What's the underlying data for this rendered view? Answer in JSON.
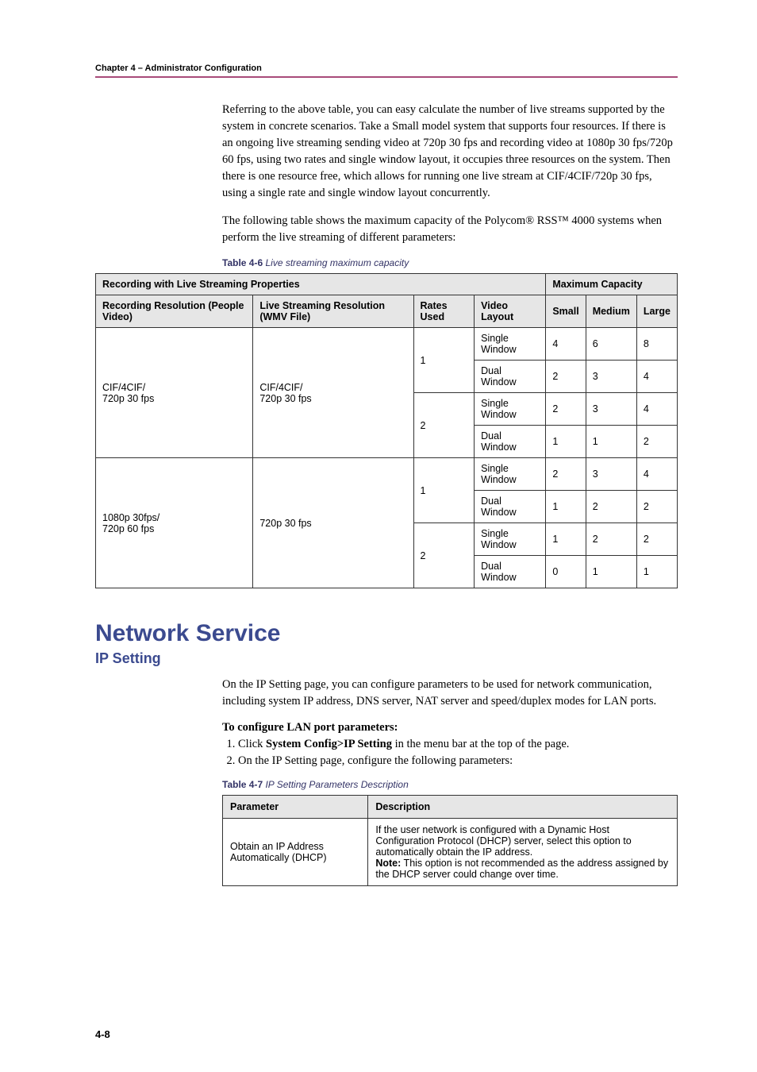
{
  "header": {
    "chapter": "Chapter 4 – Administrator Configuration"
  },
  "paragraphs": {
    "p1": "Referring to the above table, you can easy calculate the number of live streams supported by the system in concrete scenarios. Take a Small model system that supports four resources. If there is an ongoing live streaming sending video at 720p 30 fps and recording video at 1080p 30 fps/720p 60 fps, using two rates and single window layout, it occupies three resources on the system. Then there is one resource free, which allows for running one live stream at CIF/4CIF/720p 30 fps, using a single rate and single window layout concurrently.",
    "p2": "The following table shows the maximum capacity of the Polycom® RSS™ 4000 systems when perform the live streaming of different parameters:",
    "p3": "On the IP Setting page, you can configure parameters to be used for network communication, including system IP address, DNS server, NAT server and speed/duplex modes for LAN ports.",
    "steps_header": "To configure LAN port parameters:",
    "step1_pre": "Click ",
    "step1_bold": "System Config>IP Setting",
    "step1_post": " in the menu bar at the top of the page.",
    "step2": "On the IP Setting page, configure the following parameters:"
  },
  "table46": {
    "caption_bold": "Table 4-6",
    "caption_em": " Live streaming maximum capacity",
    "header_group1": "Recording with Live Streaming Properties",
    "header_group2": "Maximum Capacity",
    "col_rec": "Recording Resolution (People Video)",
    "col_live": "Live Streaming Resolution (WMV File)",
    "col_rates": "Rates Used",
    "col_layout": "Video Layout",
    "col_small": "Small",
    "col_medium": "Medium",
    "col_large": "Large",
    "rec1": "CIF/4CIF/\n720p 30 fps",
    "live1": "CIF/4CIF/\n720p 30 fps",
    "rec2": "1080p 30fps/\n720p 60 fps",
    "live2": "720p 30 fps",
    "rate1": "1",
    "rate2": "2",
    "layout_single": "Single Window",
    "layout_dual": "Dual Window",
    "r1": {
      "s": "4",
      "m": "6",
      "l": "8"
    },
    "r2": {
      "s": "2",
      "m": "3",
      "l": "4"
    },
    "r3": {
      "s": "2",
      "m": "3",
      "l": "4"
    },
    "r4": {
      "s": "1",
      "m": "1",
      "l": "2"
    },
    "r5": {
      "s": "2",
      "m": "3",
      "l": "4"
    },
    "r6": {
      "s": "1",
      "m": "2",
      "l": "2"
    },
    "r7": {
      "s": "1",
      "m": "2",
      "l": "2"
    },
    "r8": {
      "s": "0",
      "m": "1",
      "l": "1"
    }
  },
  "section": {
    "title": "Network Service",
    "subtitle": "IP Setting"
  },
  "table47": {
    "caption_bold": "Table 4-7",
    "caption_em": " IP Setting Parameters Description",
    "col_param": "Parameter",
    "col_desc": "Description",
    "row1_param": "Obtain an IP Address Automatically (DHCP)",
    "row1_desc_pre": "If the user network is configured with a Dynamic Host Configuration Protocol (DHCP) server, select this option to automatically obtain the IP address.",
    "row1_desc_note_label": "Note:",
    "row1_desc_note_body": " This option is not recommended as the address assigned by the DHCP server could change over time."
  },
  "page_number": "4-8"
}
